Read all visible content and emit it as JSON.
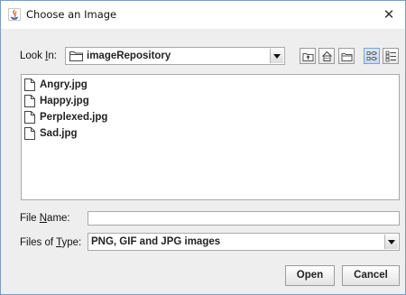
{
  "window": {
    "title": "Choose an Image"
  },
  "look_in": {
    "label_prefix": "Look ",
    "label_mnemonic": "I",
    "label_suffix": "n:",
    "value": "imageRepository"
  },
  "toolbar": {
    "buttons": [
      "up-one-level-icon",
      "home-icon",
      "new-folder-icon",
      "list-view-icon",
      "details-view-icon"
    ]
  },
  "files": [
    {
      "name": "Angry.jpg"
    },
    {
      "name": "Happy.jpg"
    },
    {
      "name": "Perplexed.jpg"
    },
    {
      "name": "Sad.jpg"
    }
  ],
  "file_name": {
    "label_prefix": "File ",
    "label_mnemonic": "N",
    "label_suffix": "ame:",
    "value": ""
  },
  "file_type": {
    "label_prefix": "Files of ",
    "label_mnemonic": "T",
    "label_suffix": "ype:",
    "value": "PNG, GIF and JPG images"
  },
  "actions": {
    "open": "Open",
    "cancel": "Cancel"
  }
}
